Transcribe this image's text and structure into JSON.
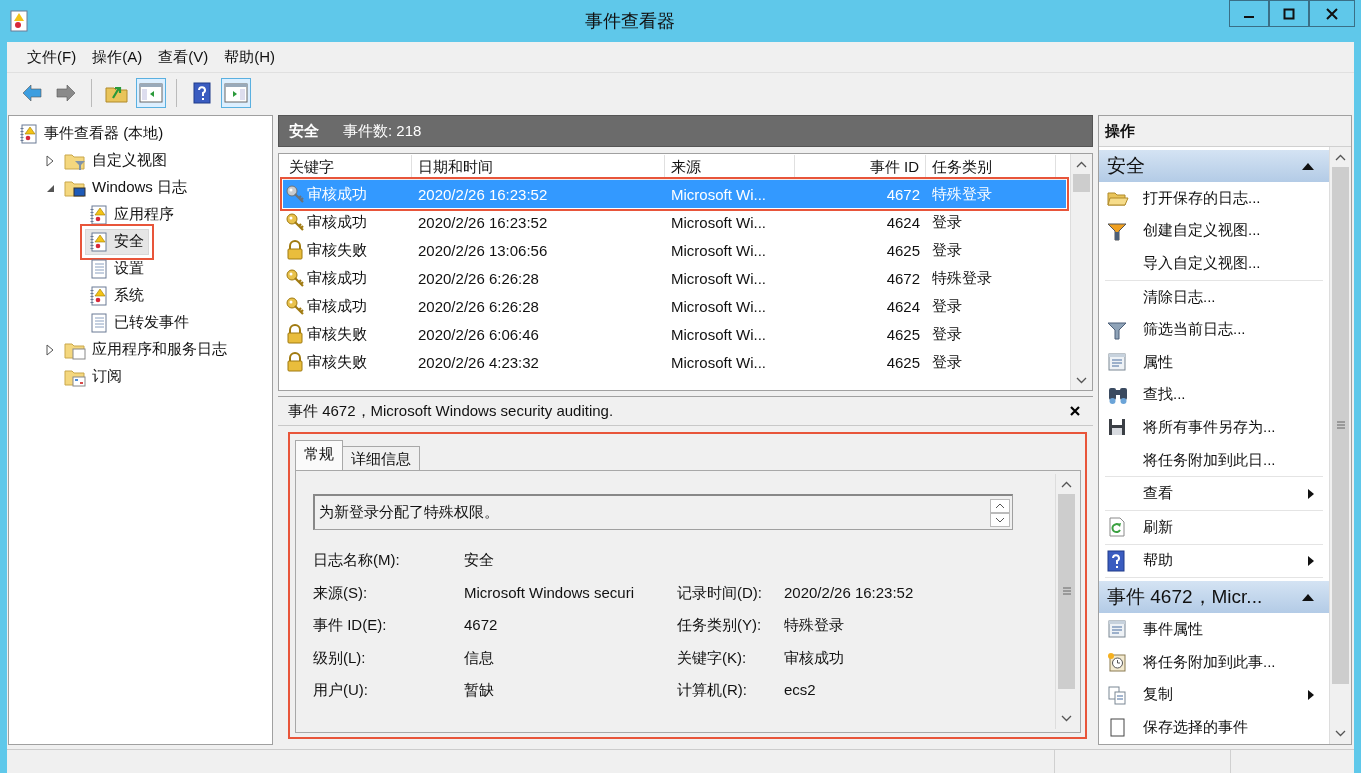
{
  "window": {
    "title": "事件查看器"
  },
  "menu": [
    {
      "label": "文件(F)"
    },
    {
      "label": "操作(A)"
    },
    {
      "label": "查看(V)"
    },
    {
      "label": "帮助(H)"
    }
  ],
  "toolbar": [
    {
      "kind": "back",
      "disabled": false
    },
    {
      "kind": "forward",
      "disabled": true
    },
    {
      "kind": "up"
    },
    {
      "kind": "show_tree",
      "pressed": true
    },
    {
      "kind": "help"
    },
    {
      "kind": "show_actions",
      "pressed": true
    }
  ],
  "tree": [
    {
      "label": "事件查看器 (本地)",
      "kind": "root",
      "selected": false,
      "annotated": false,
      "children": [
        {
          "label": "自定义视图",
          "kind": "filter_folder",
          "expanded": false,
          "selected": false,
          "annotated": false
        },
        {
          "label": "Windows 日志",
          "kind": "windows_folder",
          "expanded": true,
          "selected": false,
          "annotated": false,
          "children": [
            {
              "label": "应用程序",
              "kind": "event_log",
              "selected": false,
              "annotated": false
            },
            {
              "label": "安全",
              "kind": "event_log",
              "selected": true,
              "annotated": true
            },
            {
              "label": "设置",
              "kind": "empty_log",
              "selected": false,
              "annotated": false
            },
            {
              "label": "系统",
              "kind": "event_log",
              "selected": false,
              "annotated": false
            },
            {
              "label": "已转发事件",
              "kind": "empty_log",
              "selected": false,
              "annotated": false
            }
          ]
        },
        {
          "label": "应用程序和服务日志",
          "kind": "folder",
          "expanded": false,
          "selected": false,
          "annotated": false
        },
        {
          "label": "订阅",
          "kind": "subscriptions",
          "selected": false,
          "annotated": false
        }
      ]
    }
  ],
  "log_header": {
    "name": "安全",
    "count": "事件数: 218"
  },
  "table": {
    "columns": [
      {
        "label": "关键字"
      },
      {
        "label": "日期和时间"
      },
      {
        "label": "来源"
      },
      {
        "label": "事件 ID"
      },
      {
        "label": "任务类别"
      }
    ],
    "rows": [
      {
        "kind": "audit_success",
        "keyword": "审核成功",
        "datetime": "2020/2/26 16:23:52",
        "source": "Microsoft Wi...",
        "event_id": "4672",
        "task_category": "特殊登录",
        "selected": true,
        "annotated": true
      },
      {
        "kind": "audit_success",
        "keyword": "审核成功",
        "datetime": "2020/2/26 16:23:52",
        "source": "Microsoft Wi...",
        "event_id": "4624",
        "task_category": "登录",
        "selected": false,
        "annotated": false
      },
      {
        "kind": "audit_failure",
        "keyword": "审核失败",
        "datetime": "2020/2/26 13:06:56",
        "source": "Microsoft Wi...",
        "event_id": "4625",
        "task_category": "登录",
        "selected": false,
        "annotated": false
      },
      {
        "kind": "audit_success",
        "keyword": "审核成功",
        "datetime": "2020/2/26 6:26:28",
        "source": "Microsoft Wi...",
        "event_id": "4672",
        "task_category": "特殊登录",
        "selected": false,
        "annotated": false
      },
      {
        "kind": "audit_success",
        "keyword": "审核成功",
        "datetime": "2020/2/26 6:26:28",
        "source": "Microsoft Wi...",
        "event_id": "4624",
        "task_category": "登录",
        "selected": false,
        "annotated": false
      },
      {
        "kind": "audit_failure",
        "keyword": "审核失败",
        "datetime": "2020/2/26 6:06:46",
        "source": "Microsoft Wi...",
        "event_id": "4625",
        "task_category": "登录",
        "selected": false,
        "annotated": false
      },
      {
        "kind": "audit_failure",
        "keyword": "审核失败",
        "datetime": "2020/2/26 4:23:32",
        "source": "Microsoft Wi...",
        "event_id": "4625",
        "task_category": "登录",
        "selected": false,
        "annotated": false
      }
    ]
  },
  "detail": {
    "title": "事件 4672，Microsoft Windows security auditing.",
    "annotated": true,
    "tabs": [
      {
        "label": "常规",
        "selected": true
      },
      {
        "label": "详细信息",
        "selected": false
      }
    ],
    "description": "为新登录分配了特殊权限。",
    "fields": [
      {
        "left": {
          "label": "日志名称(M):",
          "value": "安全"
        }
      },
      {
        "left": {
          "label": "来源(S):",
          "value": "Microsoft Windows securi"
        },
        "right": {
          "label": "记录时间(D):",
          "value": "2020/2/26 16:23:52"
        }
      },
      {
        "left": {
          "label": "事件 ID(E):",
          "value": "4672"
        },
        "right": {
          "label": "任务类别(Y):",
          "value": "特殊登录"
        }
      },
      {
        "left": {
          "label": "级别(L):",
          "value": "信息"
        },
        "right": {
          "label": "关键字(K):",
          "value": "审核成功"
        }
      },
      {
        "left": {
          "label": "用户(U):",
          "value": "暂缺"
        },
        "right": {
          "label": "计算机(R):",
          "value": "ecs2"
        }
      }
    ]
  },
  "actions": {
    "title": "操作",
    "sections": [
      {
        "title": "安全",
        "expanded": true,
        "groups": [
          [
            {
              "label": "打开保存的日志...",
              "kind": "open"
            },
            {
              "label": "创建自定义视图...",
              "kind": "create_view"
            },
            {
              "label": "导入自定义视图...",
              "kind": "import"
            }
          ],
          [
            {
              "label": "清除日志...",
              "kind": "clear"
            },
            {
              "label": "筛选当前日志...",
              "kind": "filter"
            },
            {
              "label": "属性",
              "kind": "properties"
            },
            {
              "label": "查找...",
              "kind": "find"
            },
            {
              "label": "将所有事件另存为...",
              "kind": "save"
            },
            {
              "label": "将任务附加到此日...",
              "kind": "attach_task"
            }
          ],
          [
            {
              "label": "查看",
              "kind": "view",
              "submenu": true
            }
          ],
          [
            {
              "label": "刷新",
              "kind": "refresh"
            }
          ],
          [
            {
              "label": "帮助",
              "kind": "help",
              "submenu": true
            }
          ]
        ]
      },
      {
        "title": "事件 4672，Micr...",
        "expanded": true,
        "groups": [
          [
            {
              "label": "事件属性",
              "kind": "event_properties"
            },
            {
              "label": "将任务附加到此事...",
              "kind": "attach_event_task"
            },
            {
              "label": "复制",
              "kind": "copy",
              "submenu": true
            },
            {
              "label": "保存选择的事件",
              "kind": "save_selected"
            }
          ]
        ]
      }
    ]
  }
}
